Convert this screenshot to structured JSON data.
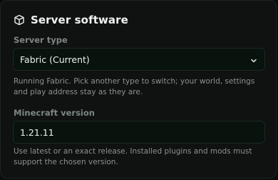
{
  "card": {
    "title": "Server software",
    "title_icon": "cube-icon"
  },
  "server_type": {
    "label": "Server type",
    "selected": "Fabric (Current)",
    "help": "Running Fabric. Pick another type to switch; your world, settings and play address stay as they are."
  },
  "minecraft_version": {
    "label": "Minecraft version",
    "value": "1.21.11",
    "help": "Use latest or an exact release. Installed plugins and mods must support the chosen version."
  },
  "colors": {
    "background": "#0f1210",
    "field_background": "#08130e",
    "text": "#eef1ef",
    "muted": "#8b928f"
  }
}
